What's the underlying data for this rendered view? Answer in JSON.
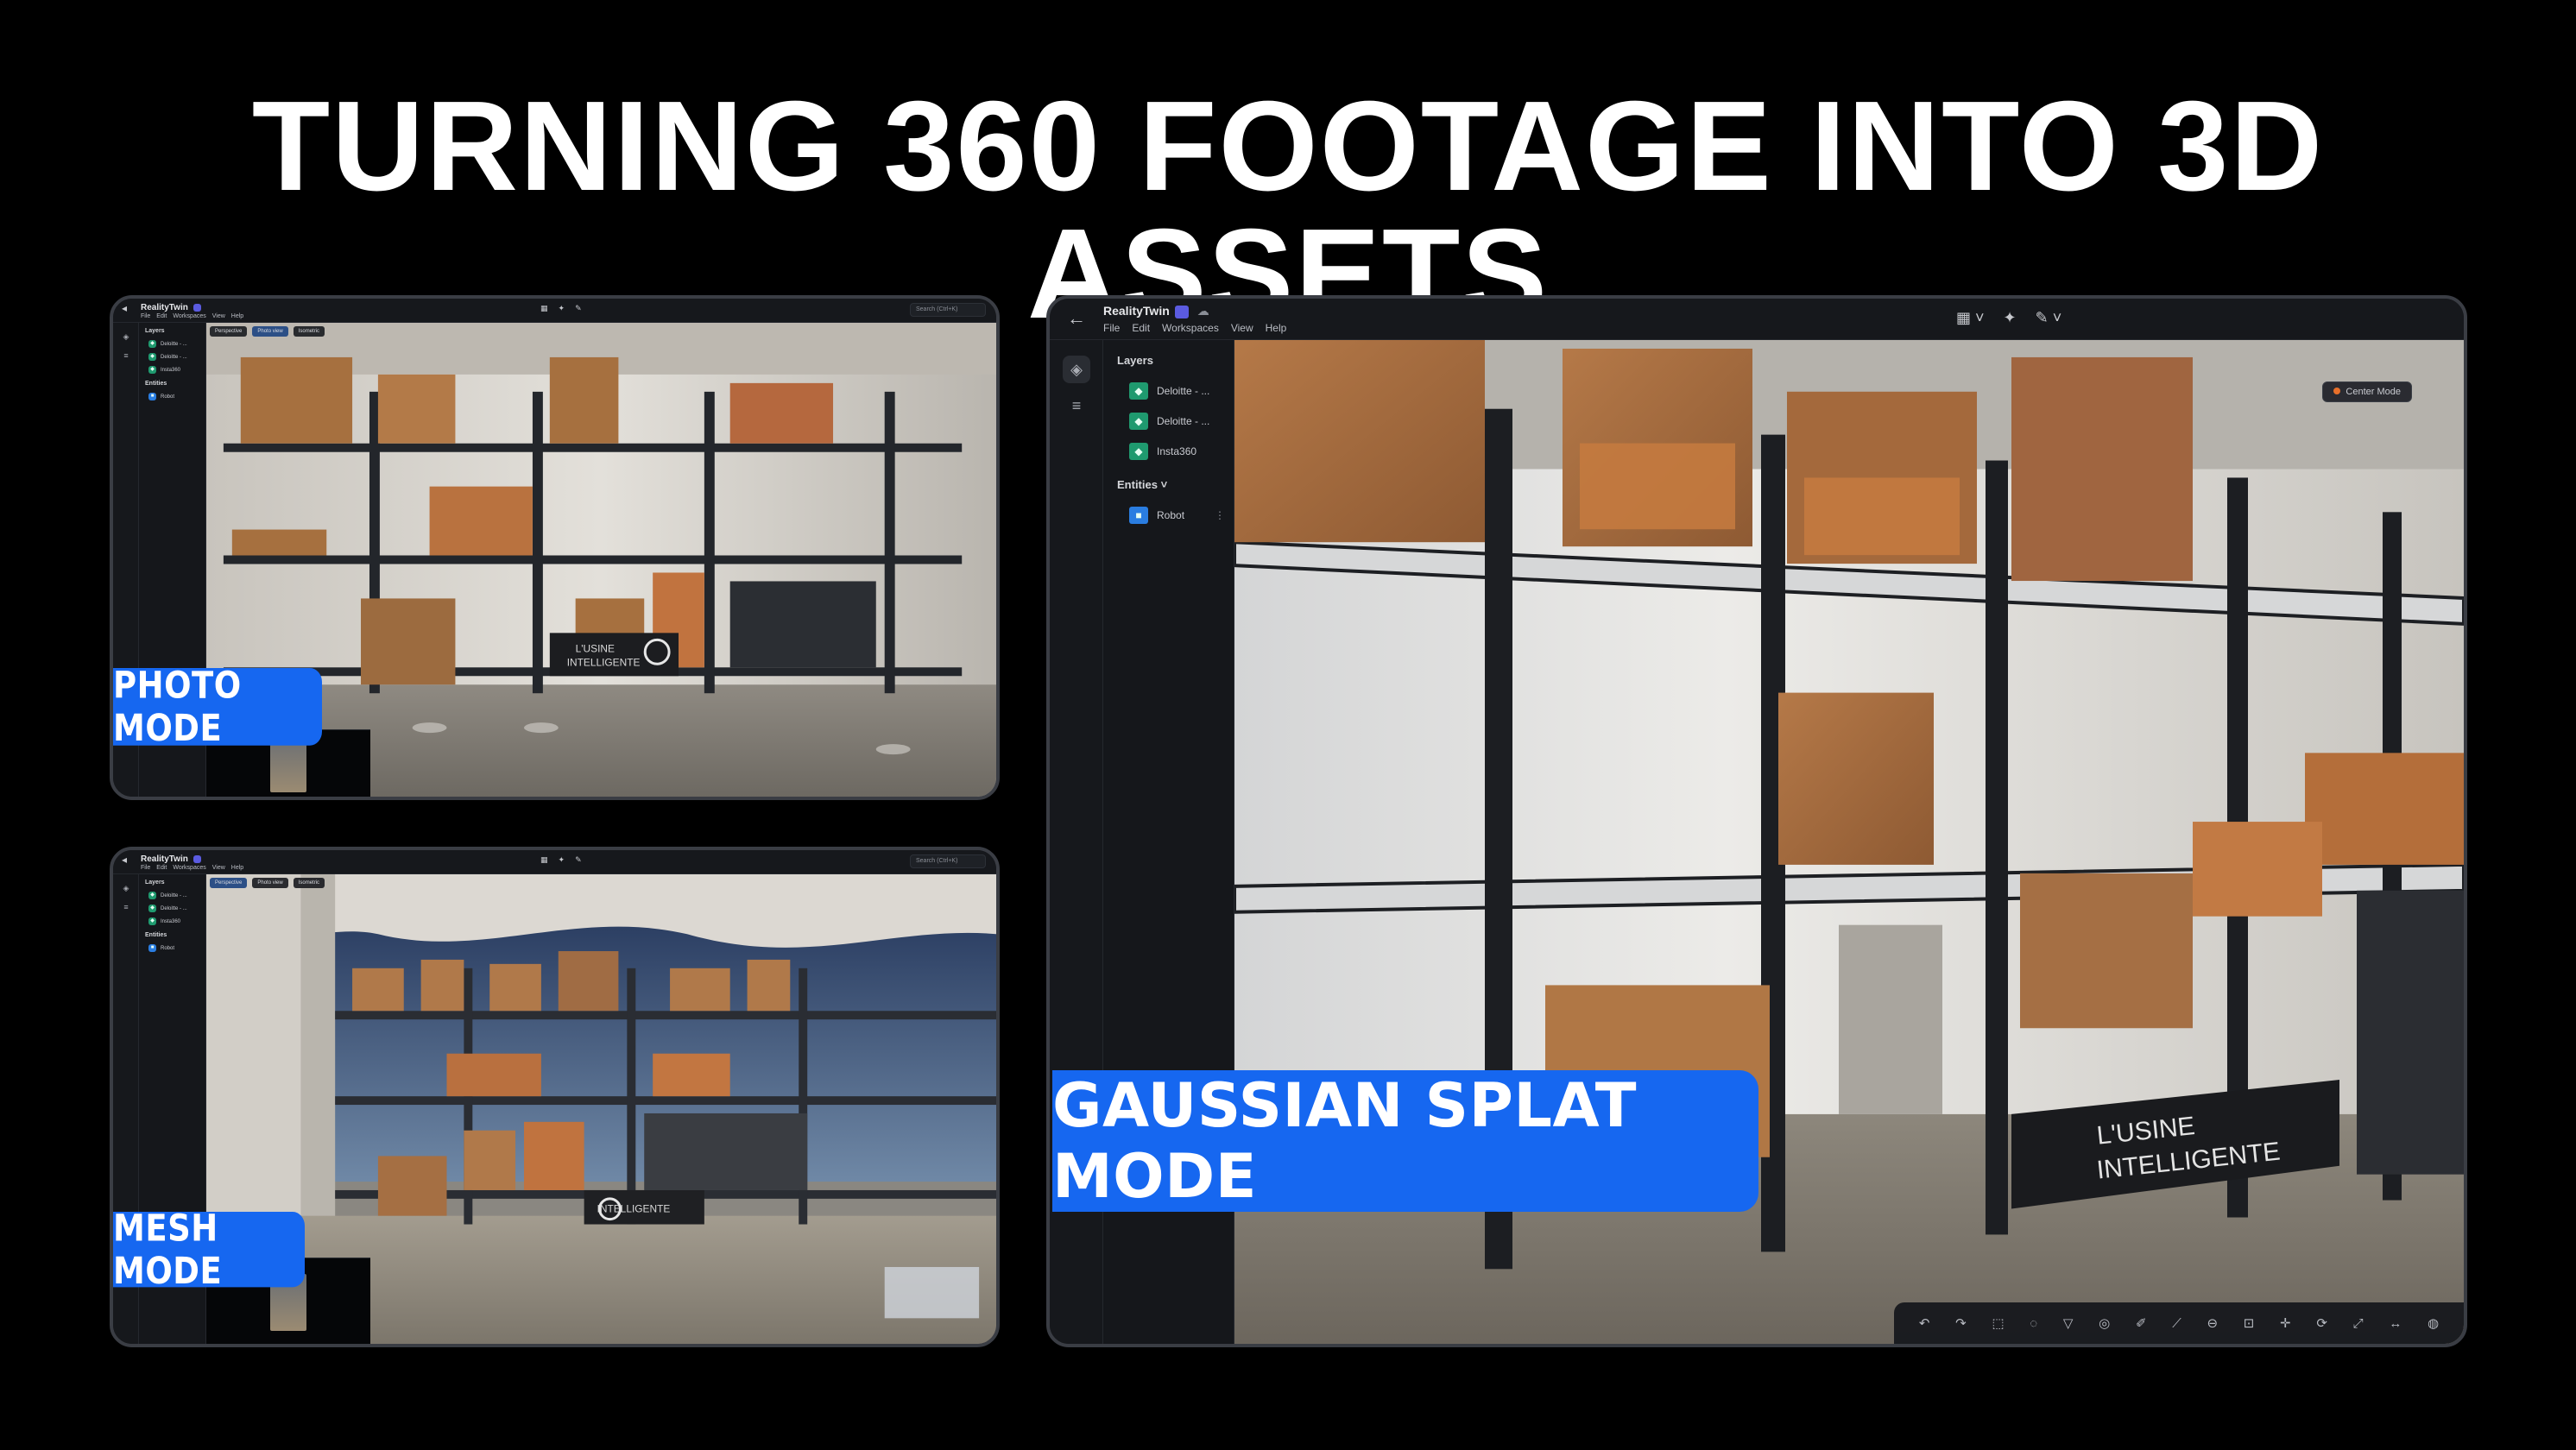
{
  "headline": "TURNING 360 FOOTAGE INTO 3D ASSETS",
  "colors": {
    "accent_blue": "#1667f0",
    "background": "#000000",
    "panel_bg": "#111317",
    "layer_icon_green": "#1f9a6f",
    "entity_icon_blue": "#2a7de1"
  },
  "app": {
    "name": "RealityTwin",
    "menu": [
      "File",
      "Edit",
      "Workspaces",
      "View",
      "Help"
    ],
    "layers_title": "Layers",
    "layers": [
      "Deloitte - ...",
      "Deloitte - ...",
      "Insta360"
    ],
    "entities_title": "Entities",
    "entities": [
      "Robot"
    ],
    "search_placeholder": "Search (Ctrl+K)",
    "viewport_tabs": [
      "Perspective",
      "Photo view",
      "Isometric"
    ],
    "center_mode": "Center Mode"
  },
  "labels": {
    "photo": "PHOTO MODE",
    "mesh": "MESH MODE",
    "gauss": "GAUSSIAN SPLAT MODE"
  },
  "scene": {
    "signage_line1": "L'USINE",
    "signage_line2": "INTELLIGENTE"
  },
  "icons": [
    "back-arrow-icon",
    "cloud-icon",
    "layers-icon",
    "filter-icon",
    "chevron-down-icon",
    "more-vertical-icon",
    "undo-icon",
    "redo-icon",
    "select-icon",
    "move-icon",
    "rotate-icon",
    "scale-icon",
    "measure-icon"
  ]
}
